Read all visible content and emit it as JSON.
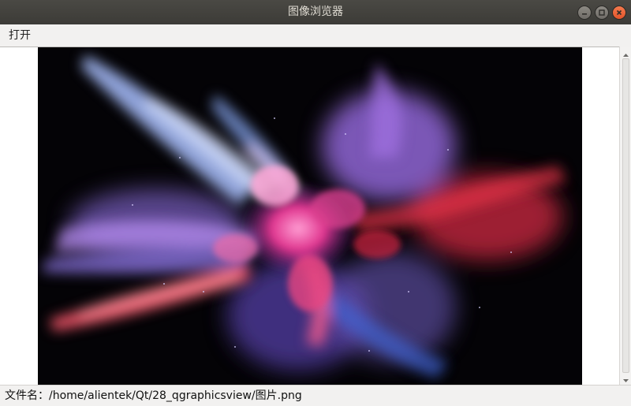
{
  "window": {
    "title": "图像浏览器",
    "buttons": [
      "minimize",
      "maximize",
      "close"
    ]
  },
  "menubar": {
    "items": [
      {
        "label": "打开"
      }
    ]
  },
  "viewer": {
    "image_description": "colorful powder explosion on black background",
    "palette": {
      "background": "#040306",
      "pink": "#e0358f",
      "blue": "#9fb4ff",
      "violet": "#8a64d8",
      "red": "#d3283e"
    }
  },
  "statusbar": {
    "text": "文件名：/home/alientek/Qt/28_qgraphicsview/图片.png"
  },
  "icons": {
    "minimize": "minimize-icon",
    "maximize": "maximize-icon",
    "close": "close-icon",
    "scroll_up": "chevron-up-icon",
    "scroll_down": "chevron-down-icon"
  }
}
